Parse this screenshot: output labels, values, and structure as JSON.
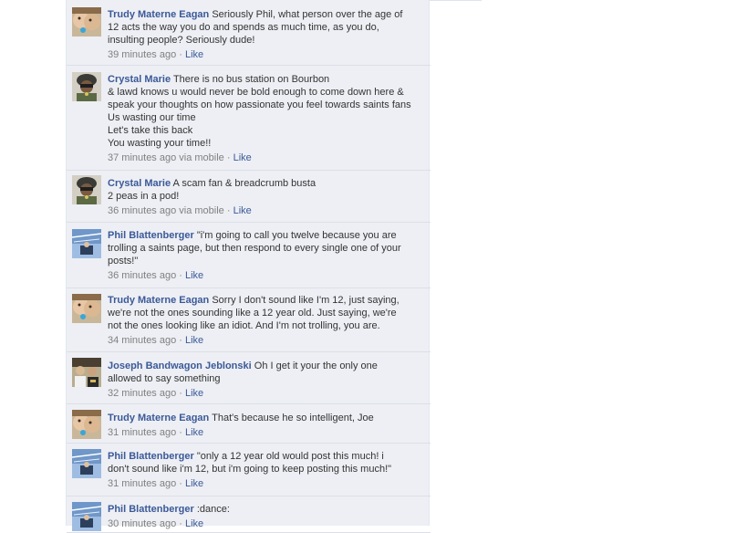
{
  "colors": {
    "link": "#3b5998",
    "feed_bg": "#edeff4",
    "meta": "#808080"
  },
  "comments": [
    {
      "author": "Trudy Materne Eagan",
      "avatar_icon": "trudy-avatar",
      "lines": [
        "Seriously Phil, what person over the age of",
        "12 acts the way you do and spends as much time, as you do,",
        "insulting people? Seriously dude!"
      ],
      "time": "39 minutes ago",
      "via": "",
      "like": "Like"
    },
    {
      "author": "Crystal Marie",
      "avatar_icon": "crystal-avatar",
      "lines": [
        "There is no bus station on Bourbon",
        "& lawd knows u would never be bold enough to come down here &",
        "speak your thoughts on how passionate you feel towards saints fans",
        "Us wasting our time",
        "Let's take this back",
        "You wasting your time!!"
      ],
      "time": "37 minutes ago",
      "via": "via mobile",
      "like": "Like"
    },
    {
      "author": "Crystal Marie",
      "avatar_icon": "crystal-avatar",
      "lines": [
        "A scam fan & breadcrumb busta",
        "2 peas in a pod!"
      ],
      "time": "36 minutes ago",
      "via": "via mobile",
      "like": "Like"
    },
    {
      "author": "Phil Blattenberger",
      "avatar_icon": "phil-avatar",
      "lines": [
        "\"i'm going to call you twelve because you are",
        "trolling a saints page, but then respond to every single one of your",
        "posts!\""
      ],
      "time": "36 minutes ago",
      "via": "",
      "like": "Like"
    },
    {
      "author": "Trudy Materne Eagan",
      "avatar_icon": "trudy-avatar",
      "lines": [
        "Sorry I don't sound like I'm 12, just saying,",
        "we're not the ones sounding like a 12 year old. Just saying, we're",
        "not the ones looking like an idiot. And I'm not trolling, you are."
      ],
      "time": "34 minutes ago",
      "via": "",
      "like": "Like"
    },
    {
      "author": "Joseph Bandwagon Jeblonski",
      "avatar_icon": "joseph-avatar",
      "lines": [
        "Oh I get it your the only one",
        "allowed to say something"
      ],
      "time": "32 minutes ago",
      "via": "",
      "like": "Like"
    },
    {
      "author": "Trudy Materne Eagan",
      "avatar_icon": "trudy-avatar",
      "lines": [
        "That's because he so intelligent, Joe"
      ],
      "time": "31 minutes ago",
      "via": "",
      "like": "Like"
    },
    {
      "author": "Phil Blattenberger",
      "avatar_icon": "phil-avatar",
      "lines": [
        "\"only a 12 year old would post this much! i",
        "don't sound like i'm 12, but i'm going to keep posting this much!\""
      ],
      "time": "31 minutes ago",
      "via": "",
      "like": "Like"
    },
    {
      "author": "Phil Blattenberger",
      "avatar_icon": "phil-avatar",
      "lines": [
        ":dance:"
      ],
      "time": "30 minutes ago",
      "via": "",
      "like": "Like"
    }
  ]
}
